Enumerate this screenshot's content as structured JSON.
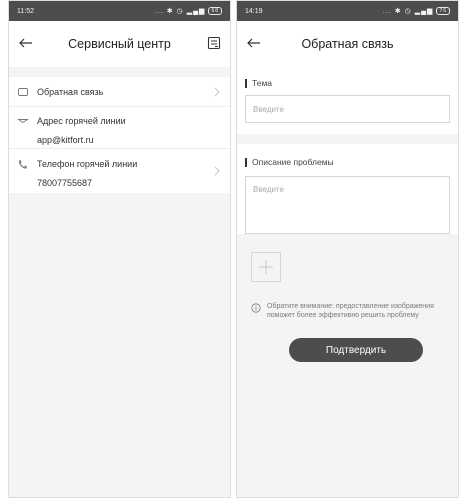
{
  "left": {
    "status": {
      "time": "11:52",
      "dots": "...",
      "battery": "68"
    },
    "header": {
      "title": "Сервисный центр"
    },
    "menu": [
      {
        "label": "Обратная связь"
      },
      {
        "label": "Адрес горячей линии",
        "value": "app@kitfort.ru"
      },
      {
        "label": "Телефон горячей линии",
        "value": "78007755687"
      }
    ]
  },
  "right": {
    "status": {
      "time": "14:19",
      "dots": "...",
      "battery": "76"
    },
    "header": {
      "title": "Обратная связь"
    },
    "form": {
      "topic_label": "Тема",
      "topic_placeholder": "Введите",
      "description_label": "Описание проблемы",
      "description_placeholder": "Введите"
    },
    "notice": {
      "line1": "Обратите внимание: предоставление изображения",
      "line2": "поможет более эффективно решить проблему"
    },
    "submit_label": "Подтвердить"
  }
}
